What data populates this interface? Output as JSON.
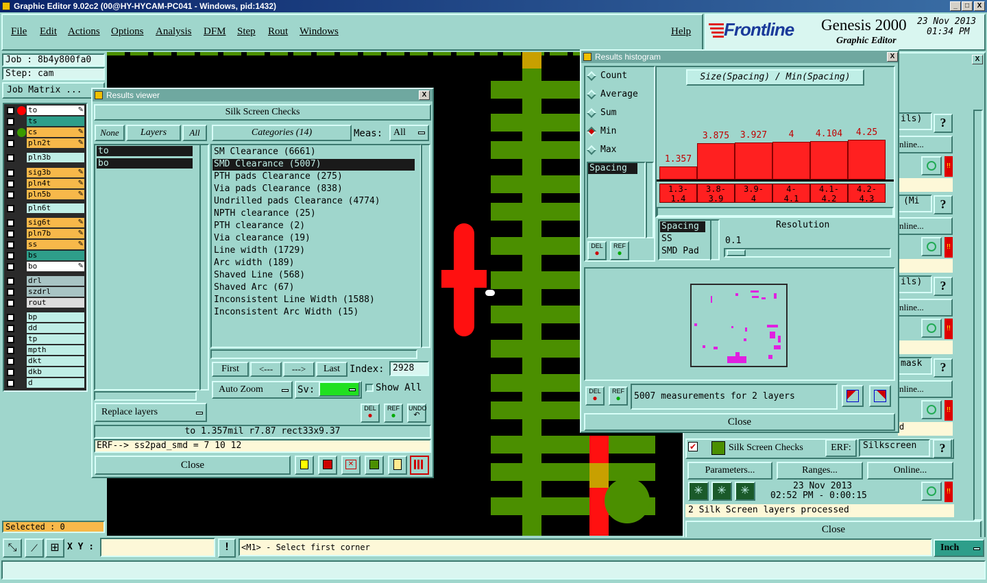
{
  "window": {
    "title": "Graphic Editor 9.02c2 (00@HY-HYCAM-PC041 - Windows, pid:1432)",
    "min": "_",
    "max": "□",
    "close": "X"
  },
  "menu": {
    "items": [
      "File",
      "Edit",
      "Actions",
      "Options",
      "Analysis",
      "DFM",
      "Step",
      "Rout",
      "Windows"
    ],
    "help": "Help"
  },
  "brand": {
    "logo": "Frontline",
    "product": "Genesis 2000",
    "subtitle": "Graphic Editor",
    "date": "23 Nov 2013",
    "time": "01:34 PM"
  },
  "left": {
    "job": "Job : 8b4y800fa0",
    "step": "Step: cam",
    "job_matrix": "Job Matrix ...",
    "selected": "Selected : 0",
    "layers": [
      {
        "name": "to",
        "color": "#ffffff",
        "dot": "#ff0000",
        "mark": "✎"
      },
      {
        "name": "ts",
        "color": "#2e9e8a",
        "dot": "",
        "mark": ""
      },
      {
        "name": "cs",
        "color": "#f7b84a",
        "dot": "#3a9a00",
        "mark": "✎"
      },
      {
        "name": "pln2t",
        "color": "#f7b84a",
        "dot": "",
        "mark": "✎"
      },
      {
        "name": "pln3b",
        "color": "#bfeee6",
        "dot": "",
        "mark": ""
      },
      {
        "name": "sig3b",
        "color": "#f7b84a",
        "dot": "",
        "mark": "✎"
      },
      {
        "name": "pln4t",
        "color": "#f7b84a",
        "dot": "",
        "mark": "✎"
      },
      {
        "name": "pln5b",
        "color": "#f7b84a",
        "dot": "",
        "mark": "✎"
      },
      {
        "name": "pln6t",
        "color": "#bfeee6",
        "dot": "",
        "mark": ""
      },
      {
        "name": "sig6t",
        "color": "#f7b84a",
        "dot": "",
        "mark": "✎"
      },
      {
        "name": "pln7b",
        "color": "#f7b84a",
        "dot": "",
        "mark": "✎"
      },
      {
        "name": "ss",
        "color": "#f7b84a",
        "dot": "",
        "mark": "✎"
      },
      {
        "name": "bs",
        "color": "#2e9e8a",
        "dot": "",
        "mark": ""
      },
      {
        "name": "bo",
        "color": "#ffffff",
        "dot": "",
        "mark": "✎"
      },
      {
        "name": "drl",
        "color": "#a8c4c4",
        "dot": "",
        "mark": ""
      },
      {
        "name": "szdrl",
        "color": "#a8c4c4",
        "dot": "",
        "mark": ""
      },
      {
        "name": "rout",
        "color": "#dcdcdc",
        "dot": "",
        "mark": ""
      },
      {
        "name": "bp",
        "color": "#bfeee6",
        "dot": "",
        "mark": ""
      },
      {
        "name": "dd",
        "color": "#bfeee6",
        "dot": "",
        "mark": ""
      },
      {
        "name": "tp",
        "color": "#bfeee6",
        "dot": "",
        "mark": ""
      },
      {
        "name": "mpth",
        "color": "#bfeee6",
        "dot": "",
        "mark": ""
      },
      {
        "name": "dkt",
        "color": "#bfeee6",
        "dot": "",
        "mark": ""
      },
      {
        "name": "dkb",
        "color": "#bfeee6",
        "dot": "",
        "mark": ""
      },
      {
        "name": "d",
        "color": "#bfeee6",
        "dot": "",
        "mark": ""
      }
    ]
  },
  "results_viewer": {
    "title": "Results viewer",
    "heading": "Silk Screen Checks",
    "none": "None",
    "layers_label": "Layers",
    "all": "All",
    "categories_label": "Categories (14)",
    "meas_label": "Meas:",
    "meas_value": "All",
    "layers": [
      "to",
      "bo"
    ],
    "categories": [
      "SM Clearance (6661)",
      "SMD Clearance (5007)",
      "PTH pads Clearance (275)",
      "Via pads Clearance (838)",
      "Undrilled pads Clearance (4774)",
      "NPTH clearance (25)",
      "PTH clearance (2)",
      "Via clearance (19)",
      "Line width (1729)",
      "Arc width (189)",
      "Shaved Line (568)",
      "Shaved Arc (67)",
      "Inconsistent Line Width (1588)",
      "Inconsistent Arc Width (15)"
    ],
    "first": "First",
    "prev": "<---",
    "next": "--->",
    "last": "Last",
    "index_label": "Index:",
    "index_value": "2928",
    "auto_zoom": "Auto Zoom",
    "sv": "Sv:",
    "show_all": "Show All",
    "replace_layers": "Replace layers",
    "del": "DEL",
    "ref": "REF",
    "undo": "UNDO",
    "info": "to 1.357mil r7.87 rect33x9.37",
    "erf": "ERF--> ss2pad_smd = 7 10 12",
    "close": "Close"
  },
  "histogram": {
    "title": "Results histogram",
    "modes": [
      "Count",
      "Average",
      "Sum",
      "Min",
      "Max"
    ],
    "selected_mode": "Min",
    "chart_title": "Size(Spacing) / Min(Spacing)",
    "left_list": [
      "Spacing"
    ],
    "del": "DEL",
    "ref": "REF",
    "bottom_list": [
      "Spacing",
      "SS",
      "SMD Pad"
    ],
    "resolution_label": "Resolution",
    "resolution_value": "0.1",
    "measurements": "5007 measurements for 2 layers",
    "close": "Close",
    "chart_data": {
      "type": "bar",
      "categories": [
        "1.3-1.4",
        "3.8-3.9",
        "3.9-4",
        "4-4.1",
        "4.1-4.2",
        "4.2-4.3"
      ],
      "values": [
        1.357,
        3.875,
        3.927,
        4,
        4.104,
        4.25
      ],
      "labels": [
        "1.357",
        "3.875",
        "3.927",
        "4",
        "4.104",
        "4.25"
      ],
      "cat_labels": [
        [
          "1.3-",
          "1.4"
        ],
        [
          "3.8-",
          "3.9"
        ],
        [
          "3.9-",
          "4"
        ],
        [
          "4-",
          "4.1"
        ],
        [
          "4.1-",
          "4.2"
        ],
        [
          "4.2-",
          "4.3"
        ]
      ],
      "title": "Size(Spacing) / Min(Spacing)",
      "ylim": [
        0,
        4.5
      ]
    }
  },
  "checks_panel": {
    "right_partial": [
      "ils)",
      "nline...",
      "(Mi",
      "nline...",
      "ils)",
      "nline...",
      "mask",
      "nline...",
      "d"
    ],
    "title": "Silk Screen Checks",
    "erf_label": "ERF:",
    "erf_value": "Silkscreen",
    "parameters": "Parameters...",
    "ranges": "Ranges...",
    "online": "Online...",
    "date": "23 Nov 2013",
    "time": "02:52 PM - 0:00:15",
    "status": "2 Silk Screen layers processed",
    "close": "Close"
  },
  "bottom": {
    "xy_label": "X Y :",
    "xy_value": "",
    "prompt": "<M1> - Select first corner",
    "units": "Inch"
  }
}
